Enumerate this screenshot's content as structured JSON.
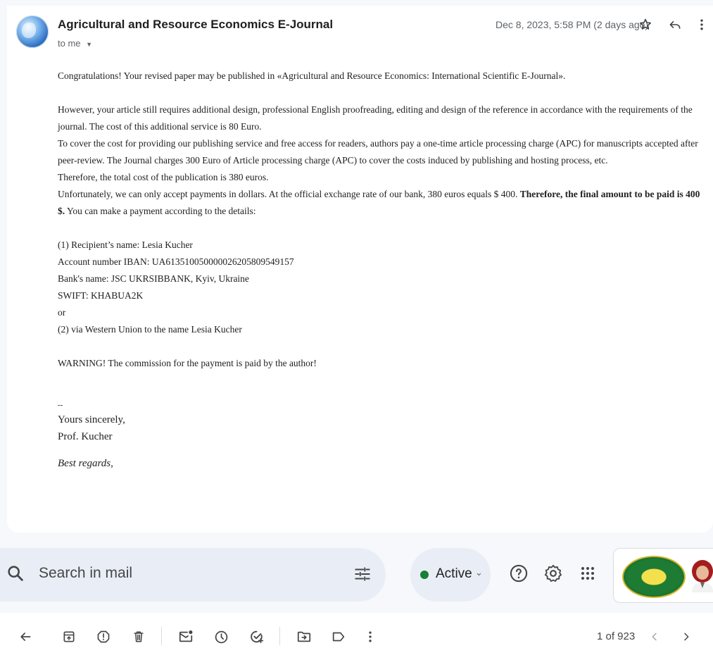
{
  "email": {
    "sender": "Agricultural and Resource Economics E-Journal",
    "recipient": "to me",
    "date": "Dec 8, 2023, 5:58 PM (2 days ago)",
    "paragraphs": {
      "p1": "Congratulations! Your revised paper may be published in «Agricultural and Resource Economics: International Scientific E-Journal».",
      "p2": "However, your article still requires additional design, professional English proofreading, editing and design of the reference in accordance with the requirements of the journal. The cost of this additional service is 80 Euro.",
      "p3": "To cover the cost for providing our publishing service and free access for readers, authors pay a one-time article processing charge (APC) for manuscripts accepted after peer-review. The Journal charges 300 Euro of Article processing charge (APC) to cover the costs induced by publishing and hosting process, etc.",
      "p4": "Therefore, the total cost of the publication is 380 euros.",
      "p5a": "Unfortunately, we can only accept payments in dollars. At the official exchange rate of our bank, 380 euros equals $ 400. ",
      "p5b": "Therefore, the final amount to be paid is 400 $.",
      "p5c": " You can make a payment according to the details:",
      "r1": "(1) Recipient’s name: Lesia Kucher",
      "r2": "Account number IBAN: UA613510050000026205809549157",
      "r3": "Bank's name: JSC UKRSIBBANK, Kyiv, Ukraine",
      "r4": "SWIFT: KHABUA2K",
      "r5": "or",
      "r6": "(2) via Western Union to the name Lesia Kucher",
      "warning": "WARNING! The commission for the payment is paid by the author!",
      "dashes": "--",
      "sig1": "Yours sincerely,",
      "sig2": "Prof. Kucher",
      "sig3": "Best regards,"
    }
  },
  "search": {
    "placeholder": "Search in mail"
  },
  "status": {
    "label": "Active"
  },
  "toolbar": {
    "counter": "1 of 923"
  },
  "icons": {
    "header": [
      "star-icon",
      "reply-icon",
      "more-vert-icon"
    ],
    "top": [
      "search-icon",
      "tune-icon",
      "help-icon",
      "settings-icon",
      "apps-icon"
    ],
    "toolbar": [
      "back-icon",
      "archive-icon",
      "report-spam-icon",
      "delete-icon",
      "mark-unread-icon",
      "snooze-icon",
      "add-task-icon",
      "move-to-icon",
      "label-icon",
      "more-vert-icon",
      "prev-icon",
      "next-icon"
    ]
  },
  "colors": {
    "active_dot": "#188038",
    "background": "#f6f8fc",
    "search_bg": "#e9eef6"
  }
}
